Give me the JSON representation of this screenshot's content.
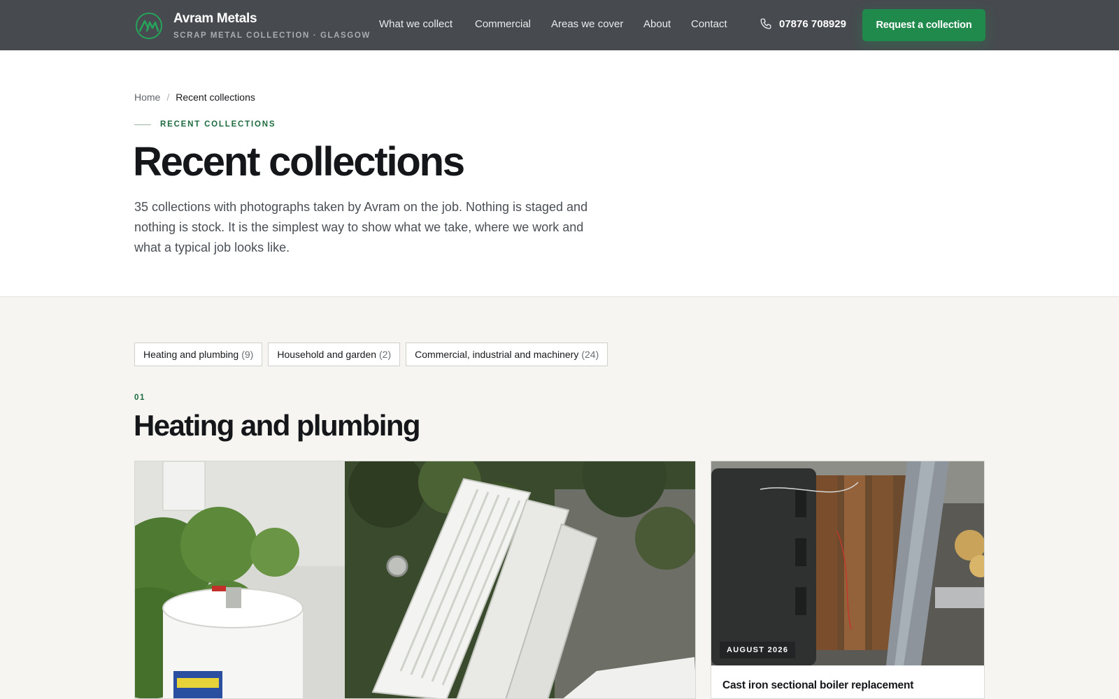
{
  "header": {
    "brand_name": "Avram Metals",
    "brand_tagline": "SCRAP METAL COLLECTION · GLASGOW",
    "logo_icon": "am-monogram-icon",
    "nav": [
      {
        "label": "What we collect"
      },
      {
        "label": "Commercial"
      },
      {
        "label": "Areas we cover"
      },
      {
        "label": "About"
      },
      {
        "label": "Contact"
      }
    ],
    "phone": "07876 708929",
    "phone_icon": "phone-icon",
    "cta_label": "Request a collection"
  },
  "breadcrumb": {
    "home": "Home",
    "separator": "/",
    "current": "Recent collections"
  },
  "hero": {
    "eyebrow": "RECENT COLLECTIONS",
    "title": "Recent collections",
    "lead": "35 collections with photographs taken by Avram on the job. Nothing is staged and nothing is stock. It is the simplest way to show what we take, where we work and what a typical job looks like."
  },
  "filters": [
    {
      "label": "Heating and plumbing",
      "count": "(9)"
    },
    {
      "label": "Household and garden",
      "count": "(2)"
    },
    {
      "label": "Commercial, industrial and machinery",
      "count": "(24)"
    }
  ],
  "section": {
    "number": "01",
    "title": "Heating and plumbing"
  },
  "cards": [
    {
      "photo": "radiators-and-cylinder-photo"
    },
    {
      "photo": "cast-iron-boiler-photo",
      "date": "AUGUST 2026",
      "title": "Cast iron sectional boiler replacement"
    }
  ],
  "colors": {
    "header_bg": "#474b4f",
    "accent_green": "#1f8a4c",
    "section_bg": "#f6f5f2"
  }
}
